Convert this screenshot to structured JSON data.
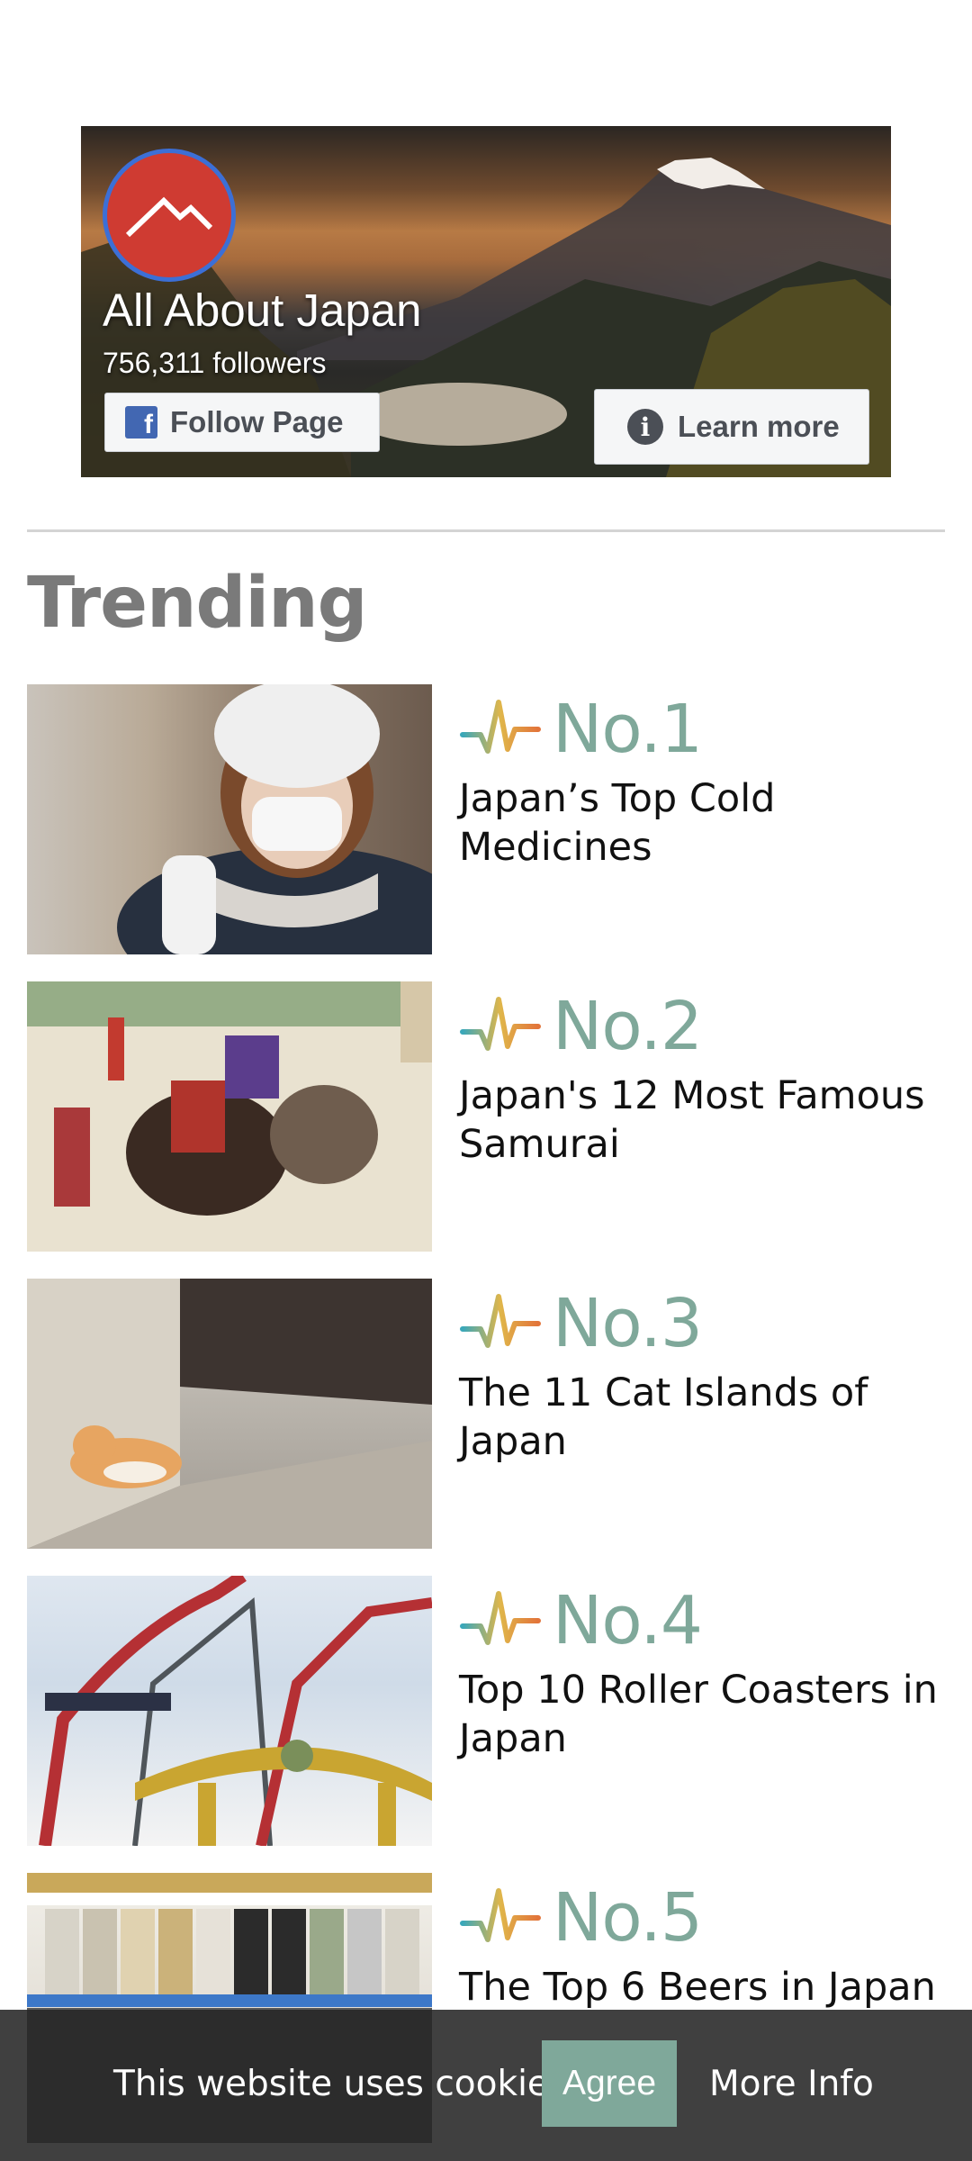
{
  "facebook_widget": {
    "page_name": "All About Japan",
    "followers": "756,311 followers",
    "follow_label": "Follow Page",
    "learn_more_label": "Learn more"
  },
  "trending": {
    "heading": "Trending",
    "items": [
      {
        "rank": "No.1",
        "title": "Japan’s Top Cold Medicines"
      },
      {
        "rank": "No.2",
        "title": "Japan's 12 Most Famous Samurai"
      },
      {
        "rank": "No.3",
        "title": "The 11 Cat Islands of Japan"
      },
      {
        "rank": "No.4",
        "title": "Top 10 Roller Coasters in Japan"
      },
      {
        "rank": "No.5",
        "title": "The Top 6 Beers in Japan"
      }
    ]
  },
  "cookie_bar": {
    "message": "This website uses cookies.",
    "agree_label": "Agree",
    "more_info_label": "More Info"
  },
  "colors": {
    "accent": "#7fa89a",
    "facebook_blue": "#4267b2",
    "logo_red": "#cf3b32"
  }
}
